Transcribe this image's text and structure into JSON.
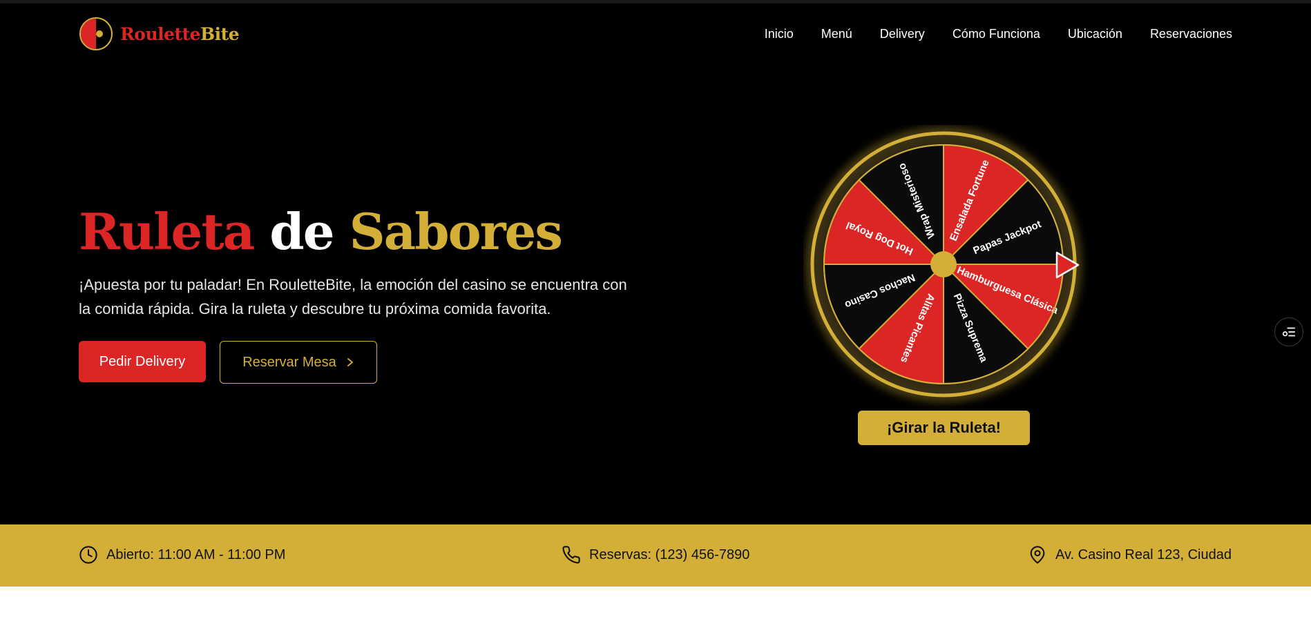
{
  "brand": {
    "name_part1": "Roulette",
    "name_part2": "Bite",
    "colors": {
      "red": "#dc2626",
      "gold": "#d4af37",
      "black": "#000000"
    }
  },
  "nav": {
    "items": [
      "Inicio",
      "Menú",
      "Delivery",
      "Cómo Funciona",
      "Ubicación",
      "Reservaciones"
    ]
  },
  "hero": {
    "title_word1": "Ruleta",
    "title_word2": "de",
    "title_word3": "Sabores",
    "description": "¡Apuesta por tu paladar! En RouletteBite, la emoción del casino se encuentra con la comida rápida. Gira la ruleta y descubre tu próxima comida favorita.",
    "primary_button": "Pedir Delivery",
    "secondary_button": "Reservar Mesa",
    "secondary_button_icon": "chevron-right-icon"
  },
  "wheel": {
    "segments": [
      {
        "label": "Ensalada Fortune",
        "color": "red"
      },
      {
        "label": "Papas Jackpot",
        "color": "black"
      },
      {
        "label": "Hamburguesa Clásica",
        "color": "red"
      },
      {
        "label": "Pizza Suprema",
        "color": "black"
      },
      {
        "label": "Alitas Picantes",
        "color": "red"
      },
      {
        "label": "Nachos Casino",
        "color": "black"
      },
      {
        "label": "Hot Dog Royal",
        "color": "red"
      },
      {
        "label": "Wrap Misterioso",
        "color": "black"
      }
    ],
    "pointer_icon": "pointer-arrow-icon",
    "spin_button": "¡Girar la Ruleta!"
  },
  "side_widget": {
    "icon": "settings-list-icon"
  },
  "info_bar": {
    "hours": {
      "icon": "clock-icon",
      "text": "Abierto: 11:00 AM - 11:00 PM"
    },
    "phone": {
      "icon": "phone-icon",
      "text": "Reservas: (123) 456-7890"
    },
    "address": {
      "icon": "map-pin-icon",
      "text": "Av. Casino Real 123, Ciudad"
    }
  }
}
